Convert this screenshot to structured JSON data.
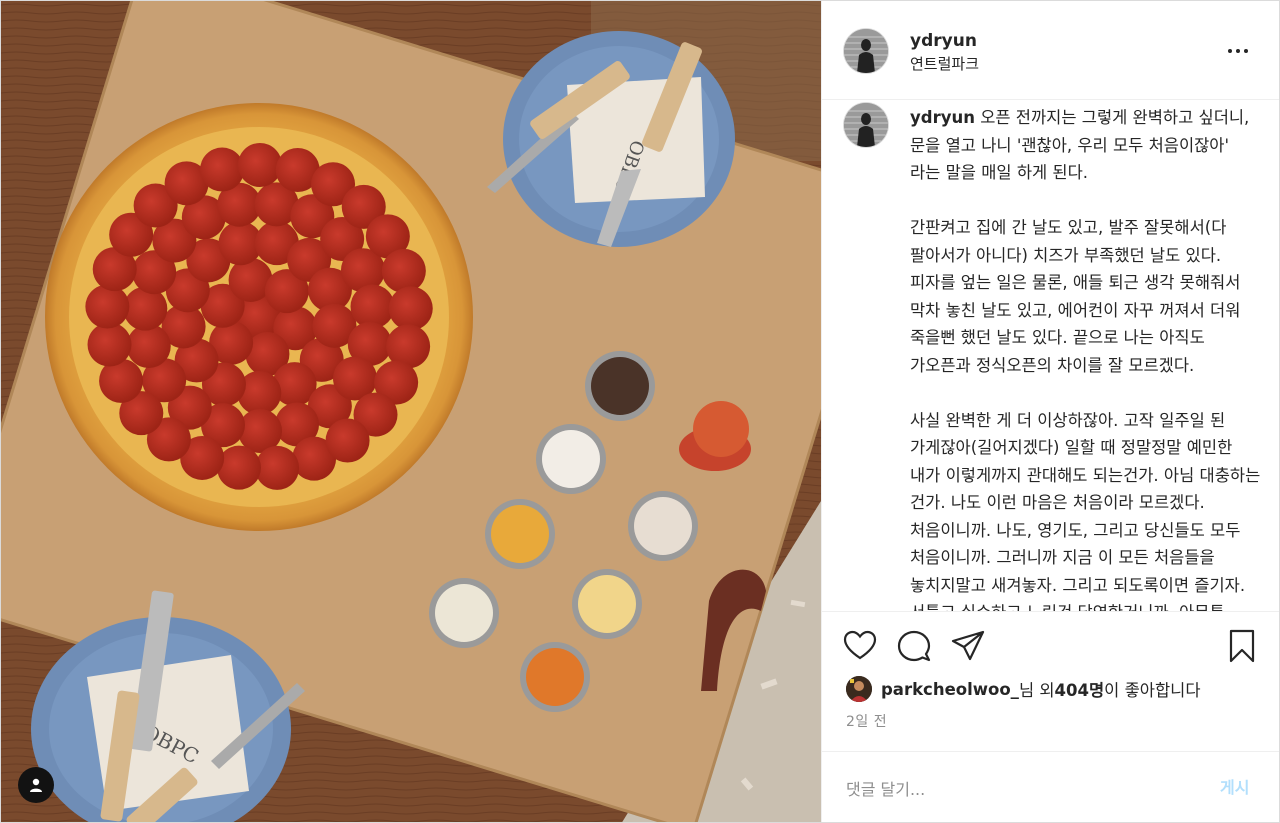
{
  "post": {
    "username": "ydryun",
    "location": "연트럴파크",
    "caption": {
      "username": "ydryun",
      "text": " 오픈 전까지는 그렇게 완벽하고 싶더니, 문을 열고 나니 '괜찮아, 우리 모두 처음이잖아' 라는 말을 매일 하게 된다.\n\n간판켜고 집에 간 날도 있고, 발주 잘못해서(다 팔아서가 아니다) 치즈가 부족했던 날도 있다. 피자를 엎는 일은 물론, 애들 퇴근 생각 못해줘서 막차 놓친 날도 있고, 에어컨이 자꾸 꺼져서 더워 죽을뻔 했던 날도 있다. 끝으로 나는 아직도 가오픈과 정식오픈의 차이를 잘 모르겠다.\n\n사실 완벽한 게 더 이상하잖아. 고작 일주일 된 가게잖아(길어지겠다) 일할 때 정말정말 예민한 내가 이렇게까지 관대해도 되는건가. 아님 대충하는 건가. 나도 이런 마음은 처음이라 모르겠다. 처음이니까. 나도, 영기도, 그리고 당신들도 모두 처음이니까. 그러니까 지금 이 모든 처음들을 놓치지말고 새겨놓자. 그리고 되도록이면 즐기자. 서툴고 실수하고 느린건 당연한거니까. 아무튼 오늘부터 정식오픈, 원바이트화이팅"
    },
    "likes": {
      "user": "parkcheolwoo_",
      "middle": "님 외 ",
      "count": "404명",
      "suffix": "이 좋아합니다"
    },
    "timestamp": "2일 전"
  },
  "comment": {
    "placeholder": "댓글 달기...",
    "post_label": "게시"
  },
  "photo": {
    "description_icons": [
      "pizza",
      "plate",
      "fork",
      "knife",
      "napkin",
      "condiment-cup"
    ],
    "napkin_logo": "OBPC"
  },
  "icons": {
    "more": "more-options-icon",
    "like": "heart-icon",
    "comment": "comment-icon",
    "share": "paper-plane-icon",
    "save": "bookmark-icon",
    "tagged": "person-icon"
  },
  "colors": {
    "link_disabled": "#b2dffc",
    "secondary_text": "#8e8e8e",
    "primary_text": "#262626",
    "divider": "#efefef"
  }
}
